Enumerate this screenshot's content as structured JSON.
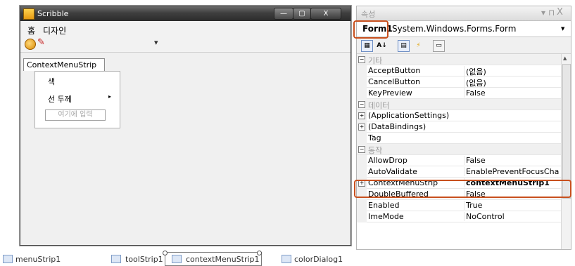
{
  "form_window": {
    "title": "Scribble",
    "caption_buttons": {
      "minimize": "—",
      "maximize": "▢",
      "close": "X"
    },
    "menu": [
      "홈",
      "디자인"
    ],
    "toolbar_dropdown": "▾",
    "context_menu_tab": "ContextMenuStrip",
    "context_menu_items": [
      "색",
      "선 두께"
    ],
    "context_menu_submenu_arrow": "▸",
    "type_here_placeholder": "여기에 입력"
  },
  "properties": {
    "title": "속성",
    "pin": "▾ ⊓",
    "close": "X",
    "object_name": "Form1",
    "object_type": "System.Windows.Forms.Form",
    "selector_arrow": "▼",
    "rows": [
      {
        "kind": "category",
        "name": "기타",
        "toggle": "⊟"
      },
      {
        "kind": "prop",
        "name": "AcceptButton",
        "value": "(없음)"
      },
      {
        "kind": "prop",
        "name": "CancelButton",
        "value": "(없음)"
      },
      {
        "kind": "prop",
        "name": "KeyPreview",
        "value": "False"
      },
      {
        "kind": "category",
        "name": "데이터",
        "toggle": "⊟"
      },
      {
        "kind": "expandable",
        "name": "(ApplicationSettings)",
        "value": "",
        "toggle": "⊞"
      },
      {
        "kind": "expandable",
        "name": "(DataBindings)",
        "value": "",
        "toggle": "⊞"
      },
      {
        "kind": "prop",
        "name": "Tag",
        "value": ""
      },
      {
        "kind": "category",
        "name": "동작",
        "toggle": "⊟"
      },
      {
        "kind": "prop",
        "name": "AllowDrop",
        "value": "False"
      },
      {
        "kind": "prop",
        "name": "AutoValidate",
        "value": "EnablePreventFocusCha"
      },
      {
        "kind": "expandable",
        "name": "ContextMenuStrip",
        "value": "contextMenuStrip1",
        "toggle": "⊞",
        "bold_value": true
      },
      {
        "kind": "prop",
        "name": "DoubleBuffered",
        "value": "False"
      },
      {
        "kind": "prop",
        "name": "Enabled",
        "value": "True"
      },
      {
        "kind": "prop",
        "name": "ImeMode",
        "value": "NoControl"
      }
    ],
    "highlight_color": "#c8501e"
  },
  "tray": {
    "items": [
      "menuStrip1",
      "toolStrip1",
      "contextMenuStrip1",
      "colorDialog1"
    ]
  }
}
